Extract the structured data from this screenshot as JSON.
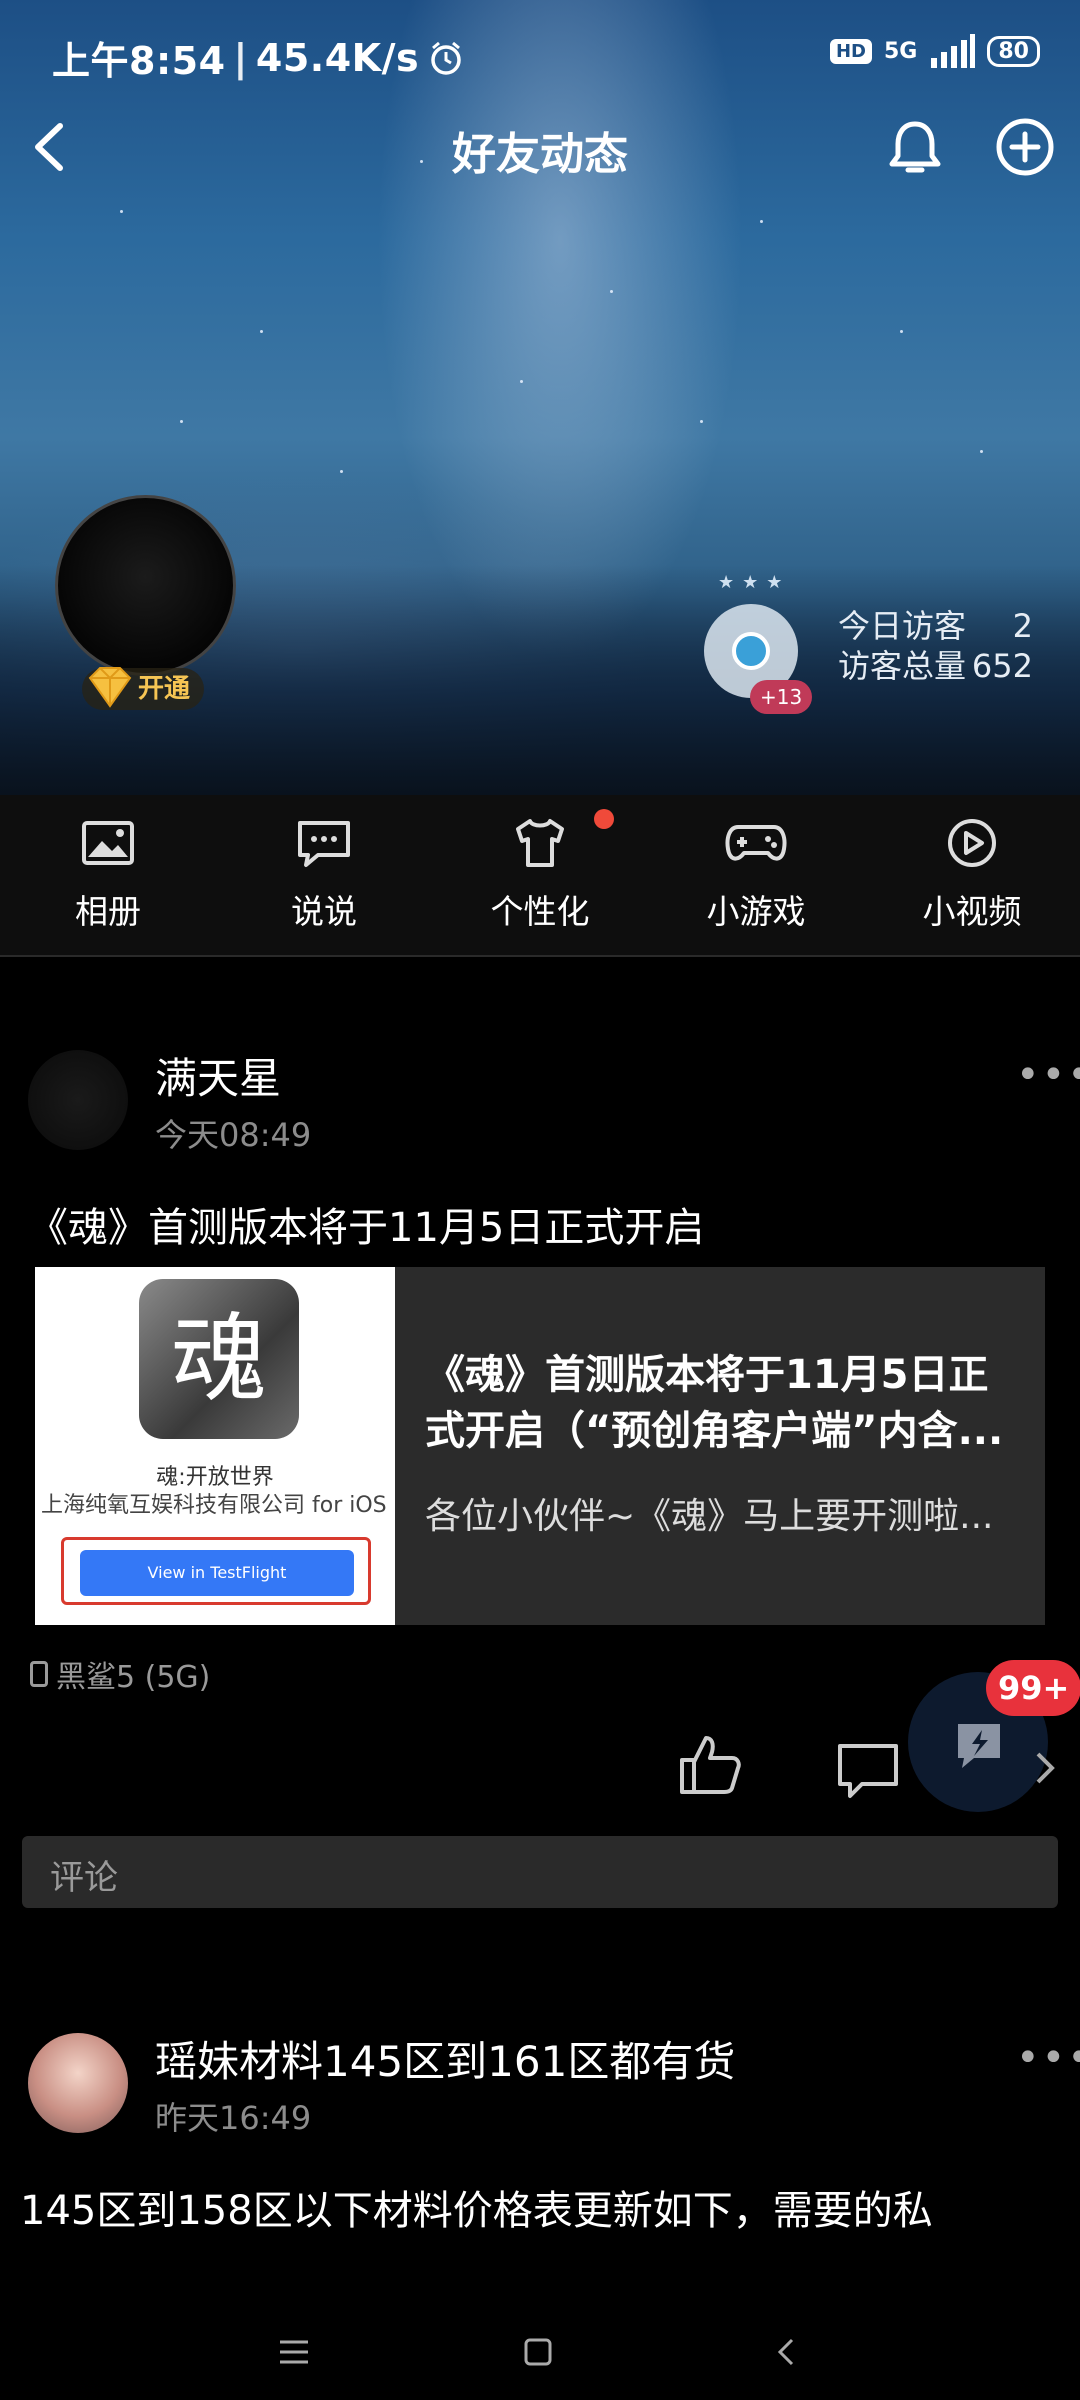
{
  "status_bar": {
    "time": "上午8:54",
    "speed": "45.4K/s",
    "hd": "HD",
    "network": "5G",
    "battery": "80"
  },
  "nav": {
    "title": "好友动态"
  },
  "profile": {
    "vip_label": "开通",
    "visitor_plus": "+13",
    "today_visitors_label": "今日访客",
    "today_visitors": "2",
    "total_visitors_label": "访客总量",
    "total_visitors": "652"
  },
  "quick_menu": [
    {
      "label": "相册",
      "icon": "photo-album-icon"
    },
    {
      "label": "说说",
      "icon": "message-icon"
    },
    {
      "label": "个性化",
      "icon": "shirt-icon"
    },
    {
      "label": "小游戏",
      "icon": "gamepad-icon"
    },
    {
      "label": "小视频",
      "icon": "play-icon"
    }
  ],
  "post1": {
    "username": "满天星",
    "time": "今天08:49",
    "text": "《魂》首测版本将于11月5日正式开启",
    "card": {
      "thumb_title": "魂:开放世界",
      "thumb_company": "上海纯氧互娱科技有限公司 for iOS",
      "thumb_button": "View in TestFlight",
      "title": "《魂》首测版本将于11月5日正式开启（“预创角客户端”内含...",
      "desc": "各位小伙伴~《魂》马上要开测啦..."
    },
    "device": "黑鲨5 (5G)",
    "comment_placeholder": "评论"
  },
  "float_badge": "99+",
  "post2": {
    "username": "瑶妹材料145区到161区都有货",
    "time": "昨天16:49",
    "text": "145区到158区以下材料价格表更新如下，需要的私"
  }
}
